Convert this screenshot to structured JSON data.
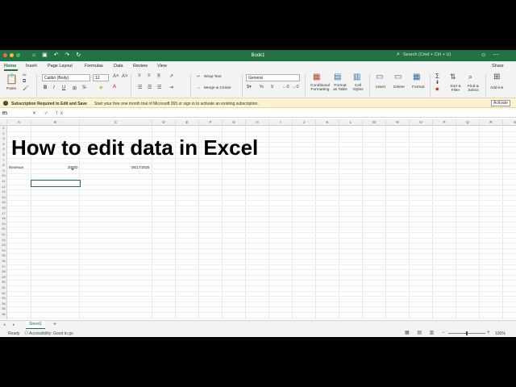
{
  "window": {
    "title": "Book1",
    "search_placeholder": "Search (Cmd + Ctrl + U)",
    "share_label": "Share"
  },
  "tabs": [
    "Home",
    "Insert",
    "Page Layout",
    "Formulas",
    "Data",
    "Review",
    "View"
  ],
  "ribbon": {
    "paste": "Paste",
    "font_name": "Calibri (Body)",
    "font_size": "12",
    "wrap_text": "Wrap Text",
    "merge_center": "Merge & Center",
    "number_format": "General",
    "conditional_formatting": [
      "Conditional",
      "Formatting"
    ],
    "format_as_table": [
      "Format",
      "as Table"
    ],
    "cell_styles": [
      "Cell",
      "Styles"
    ],
    "insert": "Insert",
    "delete": "Delete",
    "format": "Format",
    "sort_filter": [
      "Sort &",
      "Filter"
    ],
    "find_select": [
      "Find &",
      "Select"
    ],
    "add_ins": [
      "Add-ins"
    ]
  },
  "message_bar": {
    "title": "Subscription Required to Edit and Save",
    "detail": "Start your free one month trial of Microsoft 365 or sign in to activate an existing subscription.",
    "button": "Activate"
  },
  "formula_bar": {
    "name_box": "B5",
    "fx": "fx"
  },
  "columns": [
    "A",
    "B",
    "C",
    "D",
    "E",
    "F",
    "G",
    "H",
    "I",
    "J",
    "K",
    "L",
    "M",
    "N",
    "O",
    "P",
    "Q",
    "R",
    "S"
  ],
  "rows": [
    "1",
    "2",
    "3",
    "4",
    "5",
    "6",
    "7",
    "8",
    "9",
    "10",
    "11",
    "12",
    "13",
    "14",
    "15",
    "16",
    "17",
    "18",
    "19",
    "20",
    "21",
    "22",
    "23",
    "24",
    "25",
    "26",
    "27",
    "28",
    "29",
    "30",
    "31",
    "32",
    "33",
    "34",
    "35",
    "36"
  ],
  "cells": {
    "a3": "Revenue",
    "b3": "20000",
    "c3": "05/17/2025"
  },
  "headline": "How to edit data in Excel",
  "sheet_tab": "Sheet1",
  "status": {
    "ready": "Ready",
    "accessibility": "Accessibility: Good to go",
    "zoom": "100%"
  },
  "colors": {
    "brand": "#217346",
    "message_bar_bg": "#fdf3d0"
  }
}
